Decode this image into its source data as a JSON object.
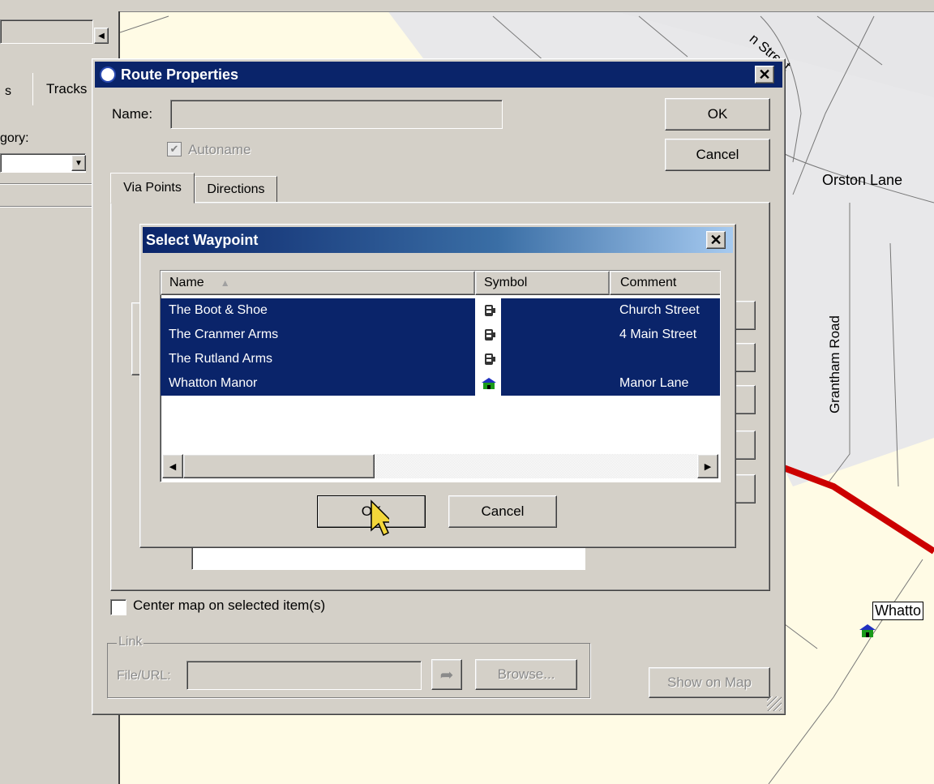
{
  "background_panel": {
    "tab_partial_s": "s",
    "tab_tracks": "Tracks",
    "category_partial": "gory:"
  },
  "map": {
    "street_partial": "n Street",
    "orston_lane": "Orston Lane",
    "grantham_road": "Grantham Road",
    "whatton_label": "Whatto",
    "route_color": "#cc0000",
    "land_color": "#fffbe5",
    "road_area_color": "#e8e8ea"
  },
  "route_props": {
    "title": "Route Properties",
    "name_label": "Name:",
    "name_value": "",
    "autoname_label": "Autoname",
    "ok_label": "OK",
    "cancel_label": "Cancel",
    "tabs": [
      {
        "label": "Via Points"
      },
      {
        "label": "Directions"
      }
    ],
    "center_map_label": "Center map on selected item(s)",
    "link_group_label": "Link",
    "file_url_label": "File/URL:",
    "file_url_value": "",
    "browse_label": "Browse...",
    "show_on_map_label": "Show on Map",
    "titlebar_color": "#0a246a"
  },
  "select_waypoint": {
    "title": "Select Waypoint",
    "columns": {
      "name": "Name",
      "symbol": "Symbol",
      "comment": "Comment"
    },
    "rows": [
      {
        "name": "The Boot & Shoe",
        "symbol": "pub-icon",
        "comment": "Church Street"
      },
      {
        "name": "The Cranmer Arms",
        "symbol": "pub-icon",
        "comment": "4 Main Street"
      },
      {
        "name": "The Rutland Arms",
        "symbol": "pub-icon",
        "comment": ""
      },
      {
        "name": "Whatton Manor",
        "symbol": "house-icon",
        "comment": "Manor Lane"
      }
    ],
    "ok_label": "OK",
    "cancel_label": "Cancel",
    "selection_color": "#0a246a"
  }
}
